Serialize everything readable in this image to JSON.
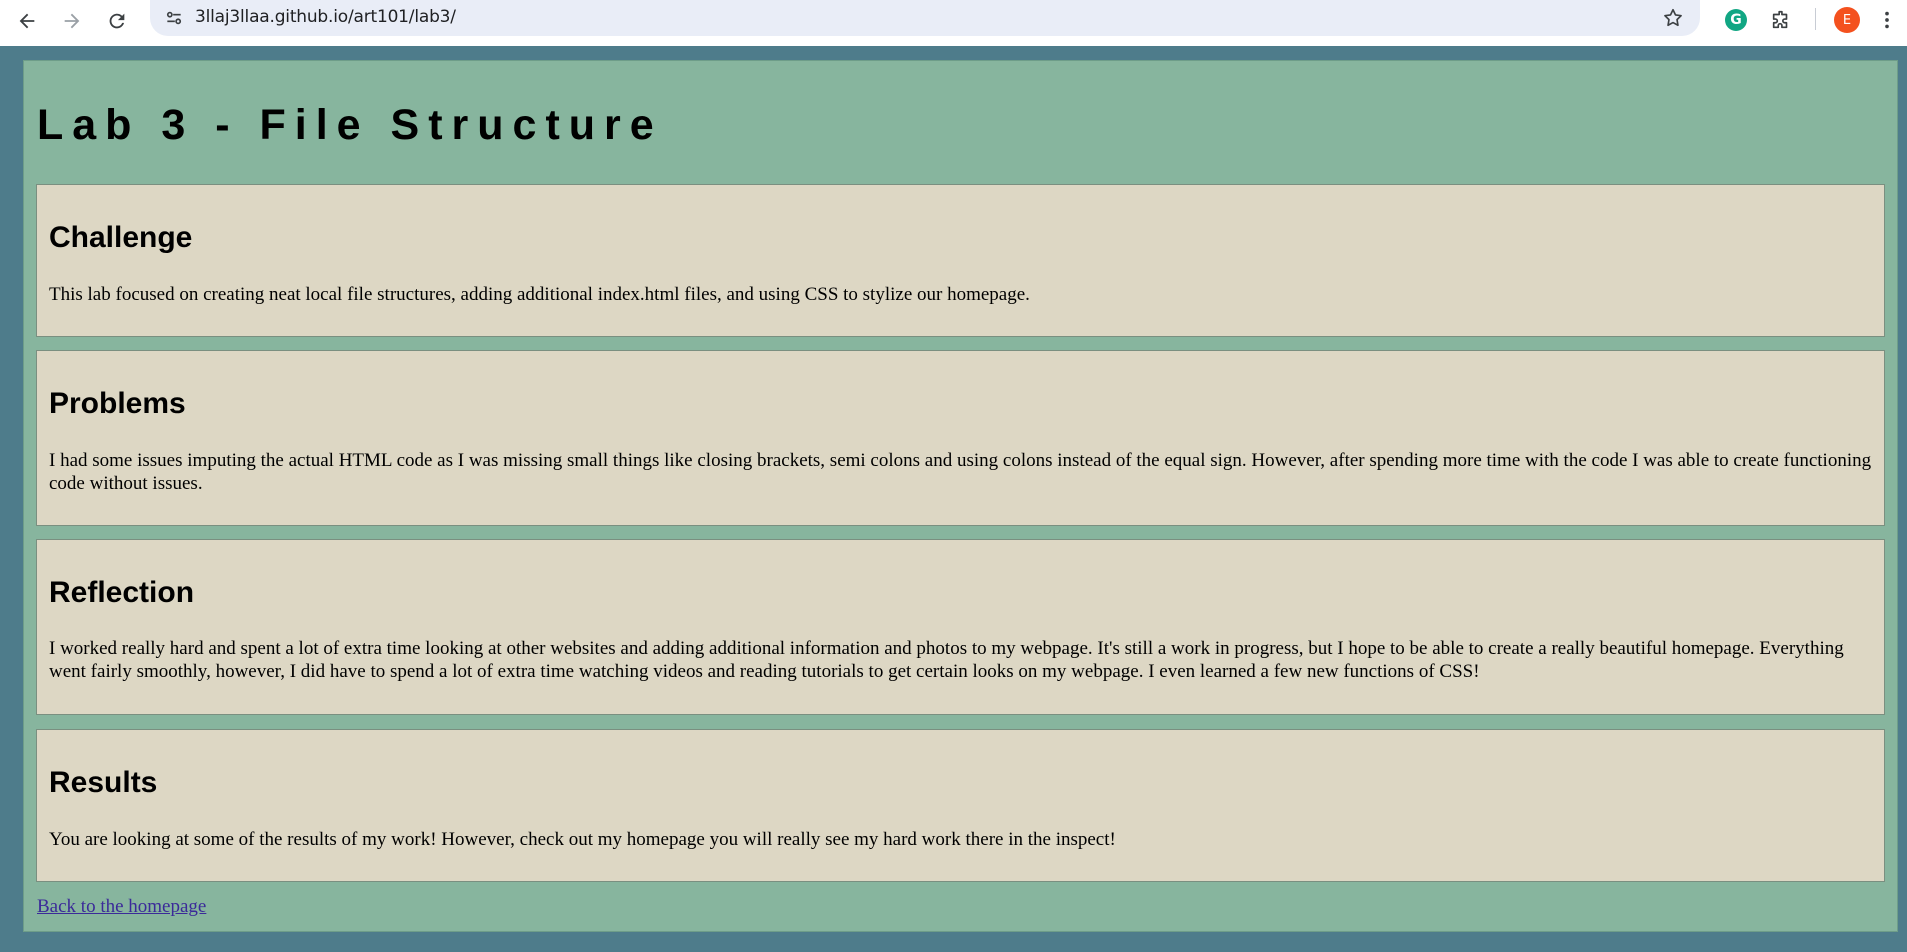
{
  "browser": {
    "url": "3llaj3llaa.github.io/art101/lab3/",
    "profile_initial": "E",
    "grammarly_letter": "G",
    "accent_profile": "#f4511e",
    "accent_grammarly": "#11a683"
  },
  "page": {
    "title": "Lab 3 - File Structure",
    "sections": [
      {
        "heading": "Challenge",
        "text": "This lab focused on creating neat local file structures, adding additional index.html files, and using CSS to stylize our homepage."
      },
      {
        "heading": "Problems",
        "text": "I had some issues imputing the actual HTML code as I was missing small things like closing brackets, semi colons and using colons instead of the equal sign. However, after spending more time with the code I was able to create functioning code without issues."
      },
      {
        "heading": "Reflection",
        "text": "I worked really hard and spent a lot of extra time looking at other websites and adding additional information and photos to my webpage. It's still a work in progress, but I hope to be able to create a really beautiful homepage. Everything went fairly smoothly, however, I did have to spend a lot of extra time watching videos and reading tutorials to get certain looks on my webpage. I even learned a few new functions of CSS!"
      },
      {
        "heading": "Results",
        "text": "You are looking at some of the results of my work! However, check out my homepage you will really see my hard work there in the inspect!"
      }
    ],
    "back_link": "Back to the homepage"
  },
  "colors": {
    "page_background": "#4e7c8b",
    "container_background": "#87b59e",
    "section_background": "#ddd7c4",
    "link": "#3b2a99"
  }
}
